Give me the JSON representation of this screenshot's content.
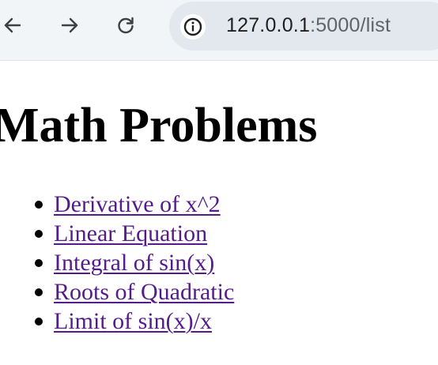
{
  "browser": {
    "url_host": "127.0.0.1",
    "url_port_path": ":5000/list",
    "icons": {
      "back": "arrow-left-icon",
      "forward": "arrow-right-icon",
      "reload": "reload-icon",
      "site_info": "info-icon"
    }
  },
  "page": {
    "title": "Math Problems",
    "problems": [
      {
        "label": "Derivative of x^2"
      },
      {
        "label": "Linear Equation"
      },
      {
        "label": "Integral of sin(x)"
      },
      {
        "label": "Roots of Quadratic"
      },
      {
        "label": "Limit of sin(x)/x"
      }
    ]
  },
  "colors": {
    "link_visited": "#551a8b",
    "toolbar_bg": "#f1f5f8",
    "omnibox_bg": "#e2e8ed"
  }
}
